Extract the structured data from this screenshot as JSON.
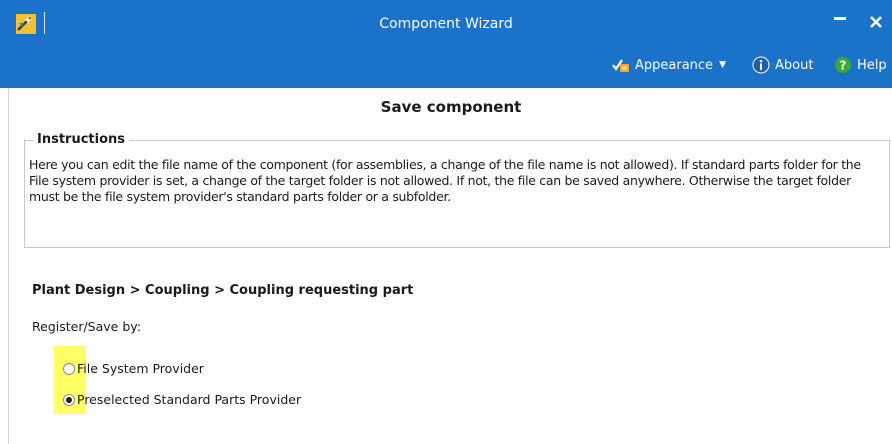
{
  "window": {
    "title": "Component Wizard",
    "accent_color": "#1a73c9",
    "app_icon": "wizard-app-icon",
    "controls": [
      "minimize-icon",
      "close-icon"
    ]
  },
  "toolbar": {
    "appearance_label": "Appearance",
    "appearance_icon": "appearance-icon",
    "about_label": "About",
    "about_icon": "info-icon",
    "help_label": "Help",
    "help_icon": "help-icon"
  },
  "page": {
    "title": "Save component",
    "instructions": {
      "legend": "Instructions",
      "text": "Here you can edit the file name of the component (for assemblies, a change of the file name is not allowed). If standard parts folder for the File system provider is set, a change of the target folder is not allowed. If not, the file can be saved anywhere. Otherwise the target folder must be the file system provider's standard parts folder or a subfolder."
    },
    "breadcrumb": "Plant Design > Coupling > Coupling requesting part",
    "register_label": "Register/Save by:",
    "options": [
      {
        "label": "File System Provider",
        "checked": false
      },
      {
        "label": "Preselected Standard Parts Provider",
        "checked": true
      }
    ],
    "highlight_color": "#ffff66"
  }
}
